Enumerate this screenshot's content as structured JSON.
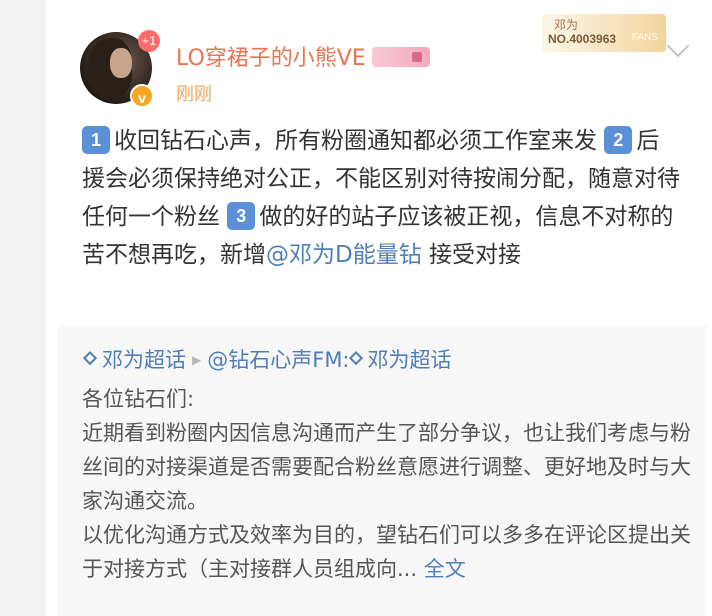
{
  "post": {
    "badge_count": "+1",
    "username": "LO穿裙子的小熊VE",
    "timestamp": "刚刚",
    "fan_card": {
      "name": "邓为",
      "number": "NO.4003963",
      "tag": "FANS"
    },
    "body": {
      "item1_num": "1",
      "item1_text": "收回钻石心声，所有粉圈通知都必须工作室来发",
      "item2_num": "2",
      "item2_text": "后援会必须保持绝对公正，不能区别对待按闹分配，随意对待任何一个粉丝",
      "item3_num": "3",
      "item3_text": "做的好的站子应该被正视，信息不对称的苦不想再吃，新增",
      "mention": "@邓为D能量钻",
      "tail": " 接受对接"
    }
  },
  "repost": {
    "topic1": "邓为超话",
    "source_user": "@钻石心声FM:",
    "topic2": "邓为超话",
    "greeting": "各位钻石们:",
    "para1": "近期看到粉圈内因信息沟通而产生了部分争议，也让我们考虑与粉丝间的对接渠道是否需要配合粉丝意愿进行调整、更好地及时与大家沟通交流。",
    "para2": "以优化沟通方式及效率为目的，望钻石们可以多多在评论区提出关于对接方式（主对接群人员组成向...",
    "full_text_link": "全文"
  },
  "colors": {
    "username": "#eb7350",
    "timestamp": "#f2a65a",
    "link": "#4e7db8",
    "number_badge": "#5b8fd6",
    "body_text": "#333333",
    "repost_bg": "#f7f7f7"
  }
}
